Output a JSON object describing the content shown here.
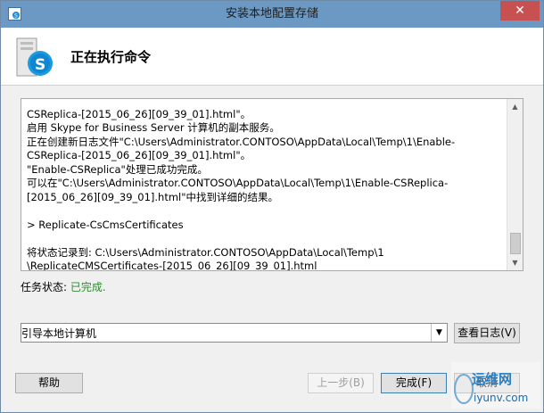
{
  "window": {
    "title": "安装本地配置存储",
    "close_label": "✕"
  },
  "header": {
    "title": "正在执行命令"
  },
  "log": {
    "lines": [
      "CSReplica-[2015_06_26][09_39_01].html\"。",
      "启用 Skype for Business Server 计算机的副本服务。",
      "正在创建新日志文件\"C:\\Users\\Administrator.CONTOSO\\AppData\\Local\\Temp\\1\\Enable-",
      "CSReplica-[2015_06_26][09_39_01].html\"。",
      "\"Enable-CSReplica\"处理已成功完成。",
      "可以在\"C:\\Users\\Administrator.CONTOSO\\AppData\\Local\\Temp\\1\\Enable-CSReplica-",
      "[2015_06_26][09_39_01].html\"中找到详细的结果。",
      "",
      "> Replicate-CsCmsCertificates",
      "",
      "将状态记录到: C:\\Users\\Administrator.CONTOSO\\AppData\\Local\\Temp\\1",
      "\\ReplicateCMSCertificates-[2015_06_26][09_39_01].html"
    ]
  },
  "status": {
    "label": "任务状态:",
    "value": "已完成."
  },
  "combo": {
    "selected": "引导本地计算机"
  },
  "buttons": {
    "view_log": "查看日志(V)",
    "help": "帮助",
    "back": "上一步(B)",
    "finish": "完成(F)",
    "cancel": "取消"
  },
  "watermark": {
    "brand": "运维网",
    "site": "iyunv.com"
  },
  "colors": {
    "title_bar": "#6b99c3",
    "close": "#c75050",
    "status_ok": "#2f8a2f"
  }
}
